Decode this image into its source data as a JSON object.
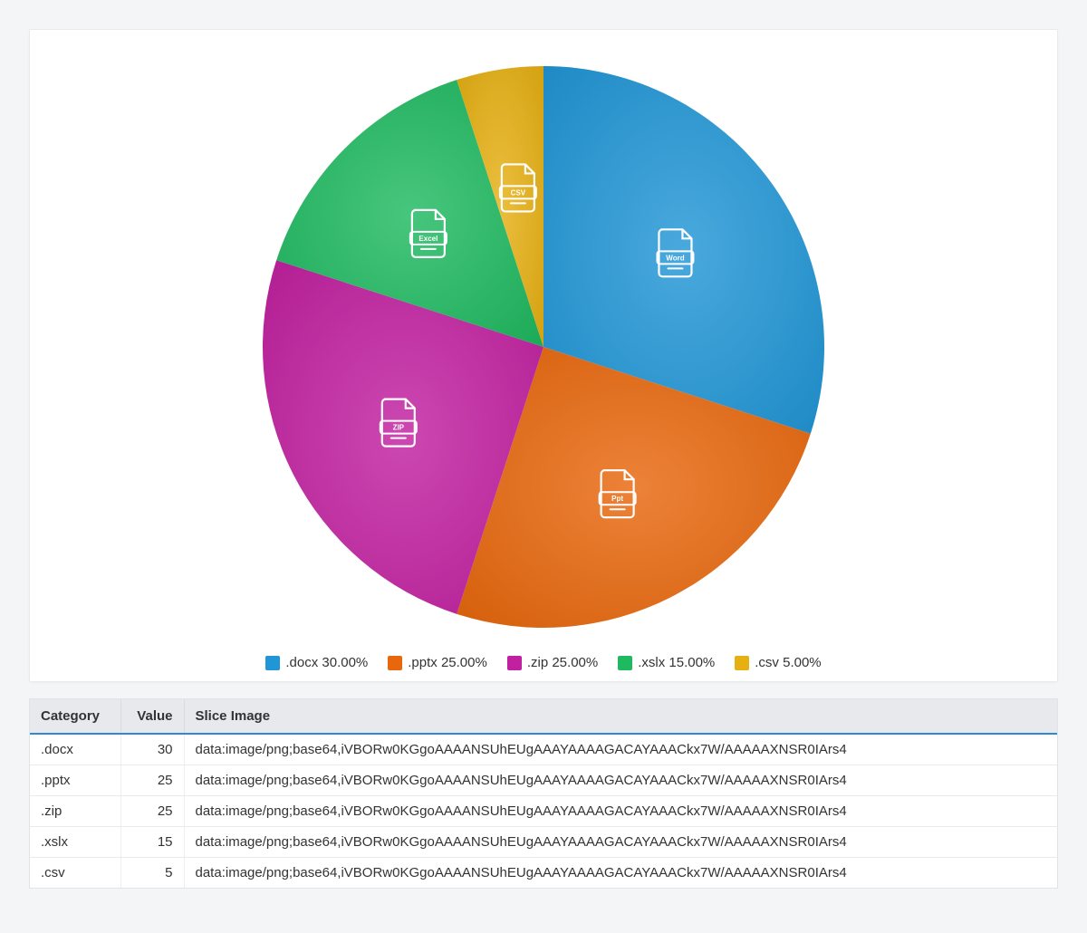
{
  "chart_data": {
    "type": "pie",
    "title": "",
    "series": [
      {
        "category": ".docx",
        "value": 30,
        "percent": "30.00%",
        "color": "#2196d6",
        "icon_label": "Word"
      },
      {
        "category": ".pptx",
        "value": 25,
        "percent": "25.00%",
        "color": "#e8670c",
        "icon_label": "Ppt"
      },
      {
        "category": ".zip",
        "value": 25,
        "percent": "25.00%",
        "color": "#c120a0",
        "icon_label": "ZIP"
      },
      {
        "category": ".xslx",
        "value": 15,
        "percent": "15.00%",
        "color": "#1eb960",
        "icon_label": "Excel"
      },
      {
        "category": ".csv",
        "value": 5,
        "percent": "5.00%",
        "color": "#e6b012",
        "icon_label": "CSV"
      }
    ],
    "legend_format": "{category} {percent}"
  },
  "table": {
    "headers": {
      "category": "Category",
      "value": "Value",
      "slice_image": "Slice Image"
    },
    "rows": [
      {
        "category": ".docx",
        "value": 30,
        "slice_image": "data:image/png;base64,iVBORw0KGgoAAAANSUhEUgAAAYAAAAGACAYAAACkx7W/AAAAAXNSR0IArs4"
      },
      {
        "category": ".pptx",
        "value": 25,
        "slice_image": "data:image/png;base64,iVBORw0KGgoAAAANSUhEUgAAAYAAAAGACAYAAACkx7W/AAAAAXNSR0IArs4"
      },
      {
        "category": ".zip",
        "value": 25,
        "slice_image": "data:image/png;base64,iVBORw0KGgoAAAANSUhEUgAAAYAAAAGACAYAAACkx7W/AAAAAXNSR0IArs4"
      },
      {
        "category": ".xslx",
        "value": 15,
        "slice_image": "data:image/png;base64,iVBORw0KGgoAAAANSUhEUgAAAYAAAAGACAYAAACkx7W/AAAAAXNSR0IArs4"
      },
      {
        "category": ".csv",
        "value": 5,
        "slice_image": "data:image/png;base64,iVBORw0KGgoAAAANSUhEUgAAAYAAAAGACAYAAACkx7W/AAAAAXNSR0IArs4"
      }
    ]
  }
}
